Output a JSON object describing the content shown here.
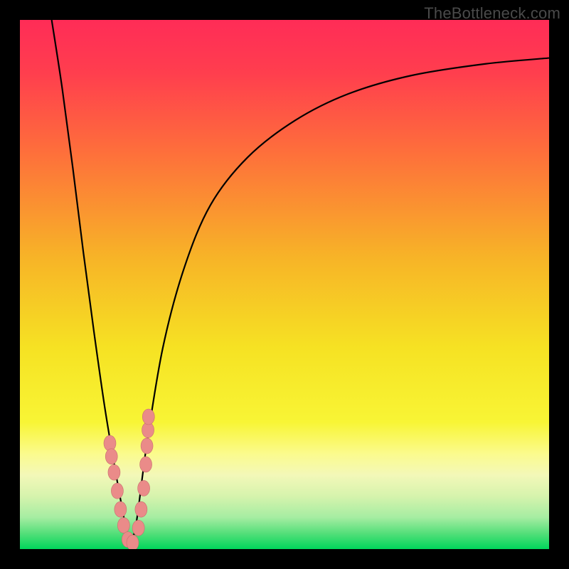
{
  "watermark": "TheBottleneck.com",
  "chart_data": {
    "type": "line",
    "title": "",
    "xlabel": "",
    "ylabel": "",
    "xlim": [
      0,
      100
    ],
    "ylim": [
      0,
      100
    ],
    "grid": false,
    "legend": false,
    "background_gradient_stops": [
      {
        "offset": 0.0,
        "color": "#ff2c57"
      },
      {
        "offset": 0.1,
        "color": "#ff3e4e"
      },
      {
        "offset": 0.25,
        "color": "#fe6f3b"
      },
      {
        "offset": 0.45,
        "color": "#f7b427"
      },
      {
        "offset": 0.62,
        "color": "#f6e223"
      },
      {
        "offset": 0.76,
        "color": "#f8f535"
      },
      {
        "offset": 0.82,
        "color": "#fbfb8d"
      },
      {
        "offset": 0.86,
        "color": "#f3f8b8"
      },
      {
        "offset": 0.9,
        "color": "#d6f3ad"
      },
      {
        "offset": 0.94,
        "color": "#a6eda2"
      },
      {
        "offset": 0.97,
        "color": "#55df7a"
      },
      {
        "offset": 1.0,
        "color": "#00d65b"
      }
    ],
    "series": [
      {
        "name": "left-branch",
        "x": [
          6.0,
          8.0,
          10.0,
          12.0,
          14.0,
          16.0,
          18.0,
          20.0,
          20.7
        ],
        "y": [
          100,
          87,
          72,
          56,
          41,
          27,
          15,
          4,
          0
        ]
      },
      {
        "name": "right-branch",
        "x": [
          20.7,
          22.0,
          24.0,
          27.0,
          31.0,
          36.0,
          43.0,
          52.0,
          62.0,
          74.0,
          88.0,
          100.0
        ],
        "y": [
          0,
          5,
          20,
          38,
          53,
          65,
          74,
          81,
          86,
          89.5,
          91.7,
          92.8
        ]
      }
    ],
    "markers": {
      "name": "highlight-points",
      "x": [
        17.0,
        17.3,
        17.8,
        18.4,
        19.0,
        19.6,
        20.4,
        21.3,
        22.4,
        22.9,
        23.4,
        23.8,
        24.0,
        24.2,
        24.3
      ],
      "y": [
        20.0,
        17.5,
        14.5,
        11.0,
        7.5,
        4.5,
        1.8,
        1.2,
        4.0,
        7.5,
        11.5,
        16.0,
        19.5,
        22.5,
        25.0
      ]
    },
    "min_point": {
      "x": 20.7,
      "y": 0
    }
  }
}
